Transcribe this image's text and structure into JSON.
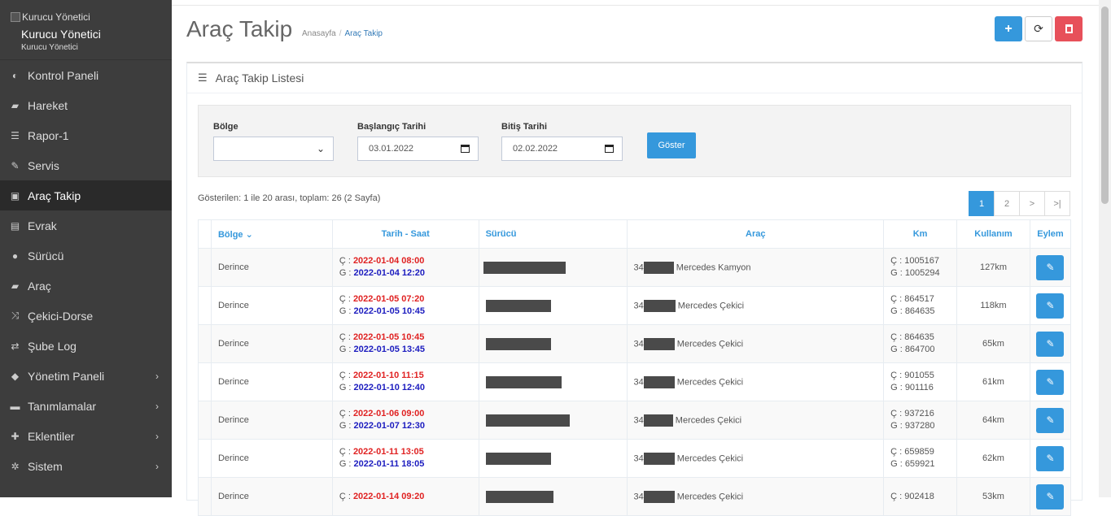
{
  "brand": {
    "logo_alt": "Kurucu Yönetici",
    "title": "Kurucu Yönetici",
    "subtitle": "Kurucu Yönetici"
  },
  "sidebar": {
    "items": [
      {
        "label": "Kontrol Paneli",
        "icon": "dashboard-icon",
        "glyph": "◐"
      },
      {
        "label": "Hareket",
        "icon": "truck-icon",
        "glyph": "▰"
      },
      {
        "label": "Rapor-1",
        "icon": "list-icon",
        "glyph": "☰"
      },
      {
        "label": "Servis",
        "icon": "wrench-icon",
        "glyph": "✎"
      },
      {
        "label": "Araç Takip",
        "icon": "car-icon",
        "glyph": "▣"
      },
      {
        "label": "Evrak",
        "icon": "newspaper-icon",
        "glyph": "▤"
      },
      {
        "label": "Sürücü",
        "icon": "user-icon",
        "glyph": "●"
      },
      {
        "label": "Araç",
        "icon": "truck-icon",
        "glyph": "▰"
      },
      {
        "label": "Çekici-Dorse",
        "icon": "random-icon",
        "glyph": "⤨"
      },
      {
        "label": "Şube Log",
        "icon": "exchange-icon",
        "glyph": "⇄"
      },
      {
        "label": "Yönetim Paneli",
        "icon": "tag-icon",
        "glyph": "◆"
      },
      {
        "label": "Tanımlamalar",
        "icon": "folder-icon",
        "glyph": "▬"
      },
      {
        "label": "Eklentiler",
        "icon": "puzzle-icon",
        "glyph": "✚"
      },
      {
        "label": "Sistem",
        "icon": "gear-icon",
        "glyph": "✲"
      }
    ]
  },
  "header": {
    "title": "Araç Takip",
    "breadcrumb": [
      "Anasayfa",
      "Araç Takip"
    ],
    "buttons": {
      "add": "+",
      "refresh": "⟳",
      "delete": "🗑"
    }
  },
  "portlet": {
    "title": "Araç Takip Listesi"
  },
  "filter": {
    "region_label": "Bölge",
    "region_value": "",
    "start_label": "Başlangıç Tarihi",
    "start_value": "03.01.2022",
    "end_label": "Bitiş Tarihi",
    "end_value": "02.02.2022",
    "show_button": "Göster"
  },
  "list_info": "Gösterilen: 1 ile 20 arası, toplam: 26 (2 Sayfa)",
  "pagination": [
    "1",
    "2",
    ">",
    ">|"
  ],
  "table": {
    "headers": {
      "region": "Bölge ⌄",
      "datetime": "Tarih - Saat",
      "driver": "Sürücü",
      "vehicle": "Araç",
      "km": "Km",
      "usage": "Kullanım",
      "action": "Eylem"
    },
    "c_prefix": "Ç : ",
    "g_prefix": "G : ",
    "rows": [
      {
        "region": "Derince",
        "c_time": "2022-01-04 08:00",
        "g_time": "2022-01-04 12:20",
        "plate_prefix": "34",
        "vehicle": "Mercedes Kamyon",
        "km_c": "Ç : 1005167",
        "km_g": "G : 1005294",
        "usage": "127km"
      },
      {
        "region": "Derince",
        "c_time": "2022-01-05 07:20",
        "g_time": "2022-01-05 10:45",
        "plate_prefix": "34",
        "vehicle": "Mercedes Çekici",
        "km_c": "Ç : 864517",
        "km_g": "G : 864635",
        "usage": "118km"
      },
      {
        "region": "Derince",
        "c_time": "2022-01-05 10:45",
        "g_time": "2022-01-05 13:45",
        "plate_prefix": "34",
        "vehicle": "Mercedes Çekici",
        "km_c": "Ç : 864635",
        "km_g": "G : 864700",
        "usage": "65km"
      },
      {
        "region": "Derince",
        "c_time": "2022-01-10 11:15",
        "g_time": "2022-01-10 12:40",
        "plate_prefix": "34",
        "vehicle": "Mercedes Çekici",
        "km_c": "Ç : 901055",
        "km_g": "G : 901116",
        "usage": "61km"
      },
      {
        "region": "Derince",
        "c_time": "2022-01-06 09:00",
        "g_time": "2022-01-07 12:30",
        "plate_prefix": "34",
        "vehicle": "Mercedes Çekici",
        "km_c": "Ç : 937216",
        "km_g": "G : 937280",
        "usage": "64km"
      },
      {
        "region": "Derince",
        "c_time": "2022-01-11 13:05",
        "g_time": "2022-01-11 18:05",
        "plate_prefix": "34",
        "vehicle": "Mercedes Çekici",
        "km_c": "Ç : 659859",
        "km_g": "G : 659921",
        "usage": "62km"
      },
      {
        "region": "Derince",
        "c_time": "2022-01-14 09:20",
        "g_time": "",
        "plate_prefix": "34",
        "vehicle": "Mercedes Çekici",
        "km_c": "Ç : 902418",
        "km_g": "",
        "usage": "53km"
      }
    ]
  }
}
